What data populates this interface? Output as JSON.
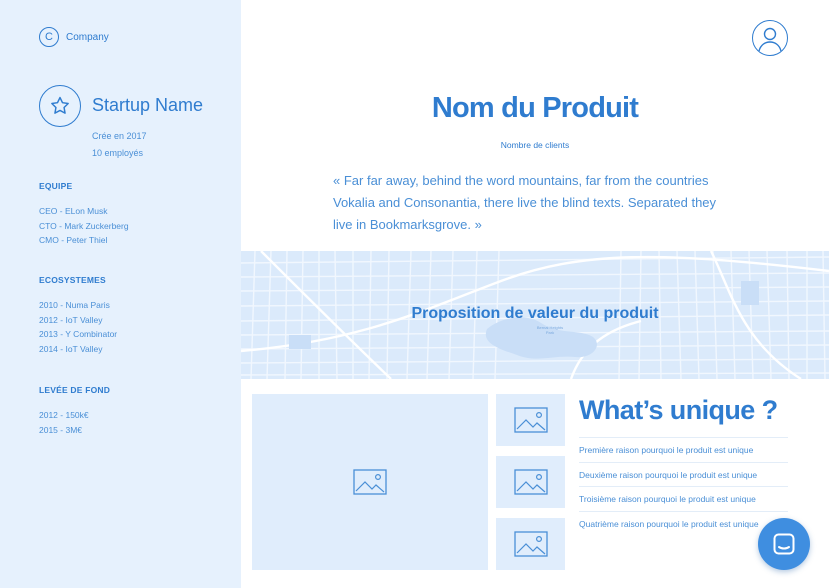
{
  "sidebar": {
    "brand": {
      "letter": "C",
      "name": "Company"
    },
    "startup": {
      "name": "Startup Name",
      "founded": "Crée en 2017",
      "employees": "10 employés"
    },
    "team": {
      "title": "EQUIPE",
      "items": [
        "CEO - ELon Musk",
        "CTO - Mark Zuckerberg",
        "CMO - Peter Thiel"
      ]
    },
    "ecosystems": {
      "title": "ECOSYSTEMES",
      "items": [
        "2010 - Numa Paris",
        "2012 - IoT Valley",
        "2013 - Y Combinator",
        "2014 - IoT Valley"
      ]
    },
    "funding": {
      "title": "LEVÉE DE FOND",
      "items": [
        "2012 - 150k€",
        "2015 - 3M€"
      ]
    }
  },
  "main": {
    "product_title": "Nom du Produit",
    "product_subtitle": "Nombre de clients",
    "quote": "« Far far away, behind the word mountains, far from the countries Vokalia and Consonantia, there live the blind texts. Separated they live in Bookmarksgrove. »",
    "value_proposition": "Proposition de valeur du produit",
    "map_label_line1": "Bernal Heights",
    "map_label_line2": "Park",
    "unique": {
      "title": "What’s unique ?",
      "items": [
        "Première raison pourquoi le produit est unique",
        "Deuxième raison pourquoi le produit est unique",
        "Troisième raison pourquoi le produit est unique",
        "Quatrième raison pourquoi le produit est unique"
      ]
    }
  },
  "colors": {
    "accent": "#2f7ccf",
    "sidebar_bg": "#e6f1fd",
    "placeholder_bg": "#e0edfc",
    "chat_button": "#3f8ee0"
  },
  "icons": {
    "brand": "copyright-c-icon",
    "startup": "star-icon",
    "avatar": "user-avatar-icon",
    "image": "image-placeholder-icon",
    "chat": "chat-bubble-icon"
  }
}
